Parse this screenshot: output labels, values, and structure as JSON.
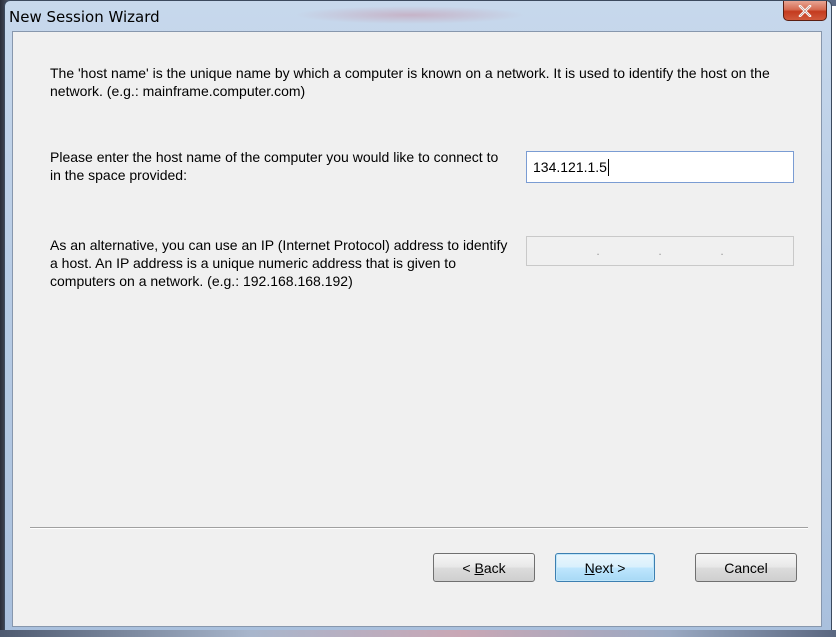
{
  "window": {
    "title": "New Session Wizard"
  },
  "content": {
    "intro": "The 'host name' is the unique name by which a computer is known on a network. It is used to identify the host on the network. (e.g.: mainframe.computer.com)",
    "prompt": "Please enter the host name of the computer you would like to connect to in the space provided:",
    "alternative": "As an alternative, you can use an IP (Internet Protocol) address to identify a host.  An IP address is a unique numeric address that is given to computers on a network. (e.g.: 192.168.168.192)"
  },
  "host_input": {
    "value": "134.121.1.5"
  },
  "ip_input": {
    "separators": [
      ".",
      ".",
      "."
    ]
  },
  "buttons": {
    "back": {
      "pre": "< ",
      "accel": "B",
      "post": "ack"
    },
    "next": {
      "pre": "",
      "accel": "N",
      "post": "ext >"
    },
    "cancel": "Cancel"
  },
  "icons": {
    "close": "close-icon"
  },
  "colors": {
    "titlebar": "#b9cde6",
    "close_button": "#c43b1f",
    "dialog_bg": "#f0f0f0",
    "default_button_border": "#3c7fb1"
  }
}
